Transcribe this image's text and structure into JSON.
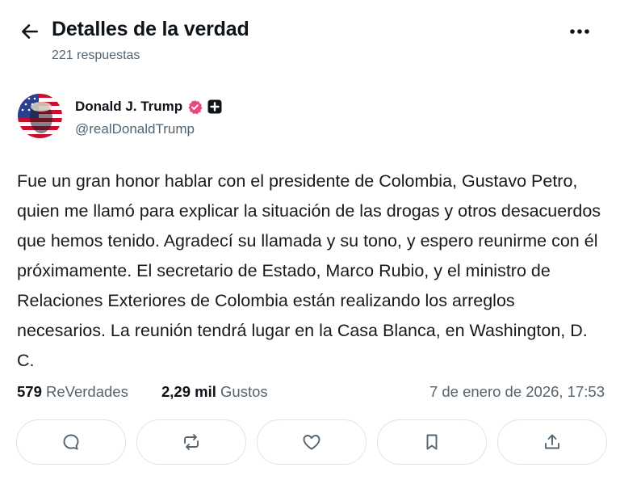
{
  "header": {
    "title": "Detalles de la verdad",
    "replies": "221 respuestas"
  },
  "author": {
    "name": "Donald J. Trump",
    "handle": "@realDonaldTrump"
  },
  "post": {
    "text": "Fue un gran honor hablar con el presidente de Colombia, Gustavo Petro, quien me llamó para explicar la situación de las drogas y otros desacuerdos que hemos tenido. Agradecí su llamada y su tono, y espero reunirme con él próximamente. El secretario de Estado, Marco Rubio, y el ministro de Relaciones Exteriores de Colombia están realizando los arreglos necesarios. La reunión tendrá lugar en la Casa Blanca, en Washington, D. C."
  },
  "stats": {
    "reposts_count": "579",
    "reposts_label": "ReVerdades",
    "likes_count": "2,29 mil",
    "likes_label": "Gustos",
    "timestamp": "7 de enero de 2026, 17:53"
  },
  "actions": [
    "reply-icon",
    "repost-icon",
    "like-icon",
    "bookmark-icon",
    "share-icon"
  ],
  "colors": {
    "verified_badge": "#e8487b",
    "secondary_text": "#536471",
    "border": "#dfe3e7"
  }
}
